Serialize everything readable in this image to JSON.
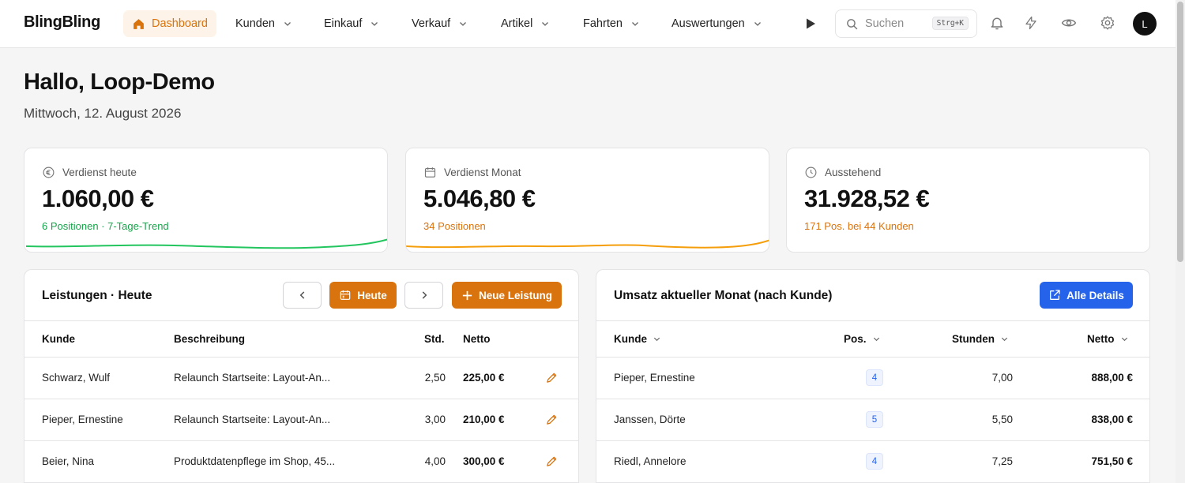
{
  "app": {
    "brand": "BlingBling"
  },
  "nav": [
    {
      "label": "Dashboard",
      "active": true
    },
    {
      "label": "Kunden"
    },
    {
      "label": "Einkauf"
    },
    {
      "label": "Verkauf"
    },
    {
      "label": "Artikel"
    },
    {
      "label": "Fahrten"
    },
    {
      "label": "Auswertungen"
    }
  ],
  "search": {
    "placeholder": "Suchen",
    "shortcut": "Strg+K"
  },
  "user": {
    "initial": "L"
  },
  "header": {
    "greeting": "Hallo, Loop-Demo",
    "date": "Mittwoch, 12. August 2026"
  },
  "stats": [
    {
      "label": "Verdienst heute",
      "value": "1.060,00 €",
      "sub": "6 Positionen · 7-Tage-Trend",
      "icon": "euro-icon",
      "color": "#16a34a"
    },
    {
      "label": "Verdienst Monat",
      "value": "5.046,80 €",
      "sub": "34 Positionen",
      "icon": "calendar-icon",
      "color": "#d9730d"
    },
    {
      "label": "Ausstehend",
      "value": "31.928,52 €",
      "sub": "171 Pos. bei 44 Kunden",
      "icon": "clock-icon",
      "color": "#d9730d"
    }
  ],
  "leistungen": {
    "title": "Leistungen · Heute",
    "today_label": "Heute",
    "new_label": "Neue Leistung",
    "columns": {
      "kunde": "Kunde",
      "beschreibung": "Beschreibung",
      "std": "Std.",
      "netto": "Netto"
    },
    "rows": [
      {
        "kunde": "Schwarz, Wulf",
        "beschreibung": "Relaunch Startseite: Layout-An...",
        "std": "2,50",
        "netto": "225,00 €"
      },
      {
        "kunde": "Pieper, Ernestine",
        "beschreibung": "Relaunch Startseite: Layout-An...",
        "std": "3,00",
        "netto": "210,00 €"
      },
      {
        "kunde": "Beier, Nina",
        "beschreibung": "Produktdatenpflege im Shop, 45...",
        "std": "4,00",
        "netto": "300,00 €"
      }
    ]
  },
  "umsatz": {
    "title": "Umsatz aktueller Monat (nach Kunde)",
    "details_label": "Alle Details",
    "columns": {
      "kunde": "Kunde",
      "pos": "Pos.",
      "stunden": "Stunden",
      "netto": "Netto"
    },
    "rows": [
      {
        "kunde": "Pieper, Ernestine",
        "pos": "4",
        "stunden": "7,00",
        "netto": "888,00 €"
      },
      {
        "kunde": "Janssen, Dörte",
        "pos": "5",
        "stunden": "5,50",
        "netto": "838,00 €"
      },
      {
        "kunde": "Riedl, Annelore",
        "pos": "4",
        "stunden": "7,25",
        "netto": "751,50 €"
      }
    ]
  },
  "colors": {
    "accent": "#d9730d",
    "green": "#16a34a",
    "blue": "#2563eb"
  }
}
